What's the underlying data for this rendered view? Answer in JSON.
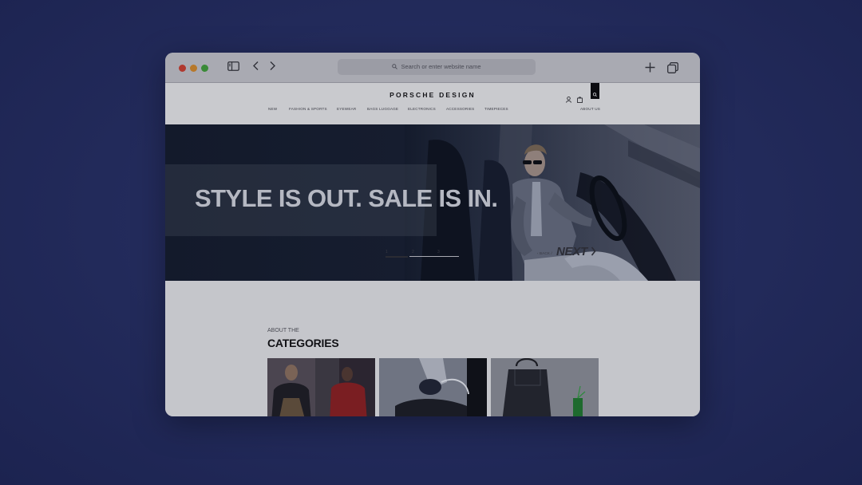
{
  "browser": {
    "address_placeholder": "Search or enter website name",
    "icons": [
      "sidebar-icon",
      "back-arrow-icon",
      "forward-arrow-icon",
      "search-icon",
      "plus-icon",
      "tabs-overview-icon"
    ]
  },
  "site": {
    "logo": "PORSCHE DESIGN",
    "nav": [
      "NEW",
      "FASHION & SPORTS",
      "EYEWEAR",
      "BAGS LUGGAGE",
      "ELECTRONICS",
      "ACCESSORIES",
      "TIMEPIECES"
    ],
    "nav_right": "ABOUT US",
    "header_icons": [
      "account-icon",
      "bag-icon",
      "search-icon"
    ]
  },
  "hero": {
    "title": "STYLE IS OUT. SALE IS IN."
  },
  "pager": {
    "pages": [
      "1",
      "2",
      "3"
    ],
    "active_page": "1",
    "back": "‹ BACK /",
    "next": "NEXT"
  },
  "categories": {
    "eyebrow": "ABOUT THE",
    "title": "CATEGORIES",
    "cards": [
      "fashion-photo",
      "eyewear-photo",
      "bags-photo"
    ]
  },
  "colors": {
    "background": "#222a5a",
    "hero": "#131a2b",
    "page": "#c5c6cb"
  }
}
